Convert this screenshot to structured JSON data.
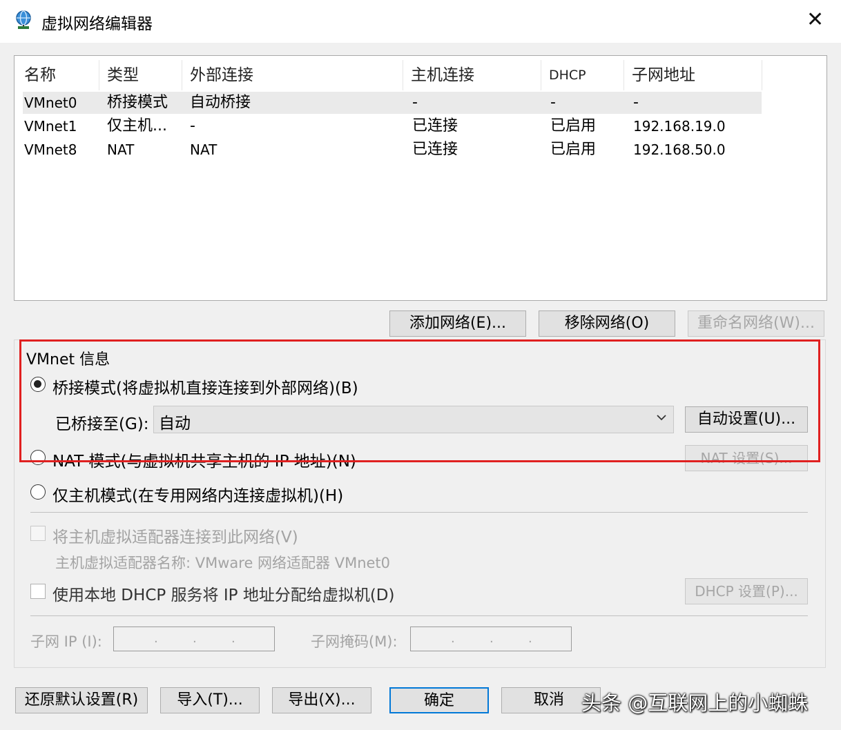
{
  "window": {
    "title": "虚拟网络编辑器",
    "close_label": "✕",
    "icon": "globe-network-icon"
  },
  "table": {
    "columns": [
      "名称",
      "类型",
      "外部连接",
      "主机连接",
      "DHCP",
      "子网地址"
    ],
    "rows": [
      [
        "VMnet0",
        "桥接模式",
        "自动桥接",
        "-",
        "-",
        "-"
      ],
      [
        "VMnet1",
        "仅主机...",
        "-",
        "已连接",
        "已启用",
        "192.168.19.0"
      ],
      [
        "VMnet8",
        "NAT",
        "NAT",
        "已连接",
        "已启用",
        "192.168.50.0"
      ]
    ]
  },
  "list_buttons": {
    "add": "添加网络(E)...",
    "remove": "移除网络(O)",
    "rename": "重命名网络(W)..."
  },
  "vmnet_info": {
    "group_label": "VMnet 信息",
    "bridged_label": "桥接模式(将虚拟机直接连接到外部网络)(B)",
    "bridged_to_label": "已桥接至(G):",
    "bridged_to_value": "自动",
    "auto_settings": "自动设置(U)...",
    "nat_label": "NAT 模式(与虚拟机共享主机的 IP 地址)(N)",
    "nat_settings": "NAT 设置(S)...",
    "hostonly_label": "仅主机模式(在专用网络内连接虚拟机)(H)",
    "connect_adapter_label": "将主机虚拟适配器连接到此网络(V)",
    "adapter_name": "主机虚拟适配器名称: VMware 网络适配器 VMnet0",
    "dhcp_label": "使用本地 DHCP 服务将 IP 地址分配给虚拟机(D)",
    "dhcp_settings": "DHCP 设置(P)...",
    "subnet_ip_label": "子网 IP (I):",
    "subnet_mask_label": "子网掩码(M):",
    "selected_mode": "bridged"
  },
  "footer": {
    "restore": "还原默认设置(R)",
    "import": "导入(T)...",
    "export": "导出(X)...",
    "ok": "确定",
    "cancel": "取消"
  },
  "watermark": "头条 @互联网上的小蜘蛛",
  "colors": {
    "highlight_box": "#e02020",
    "default_button_border": "#0078d7"
  }
}
